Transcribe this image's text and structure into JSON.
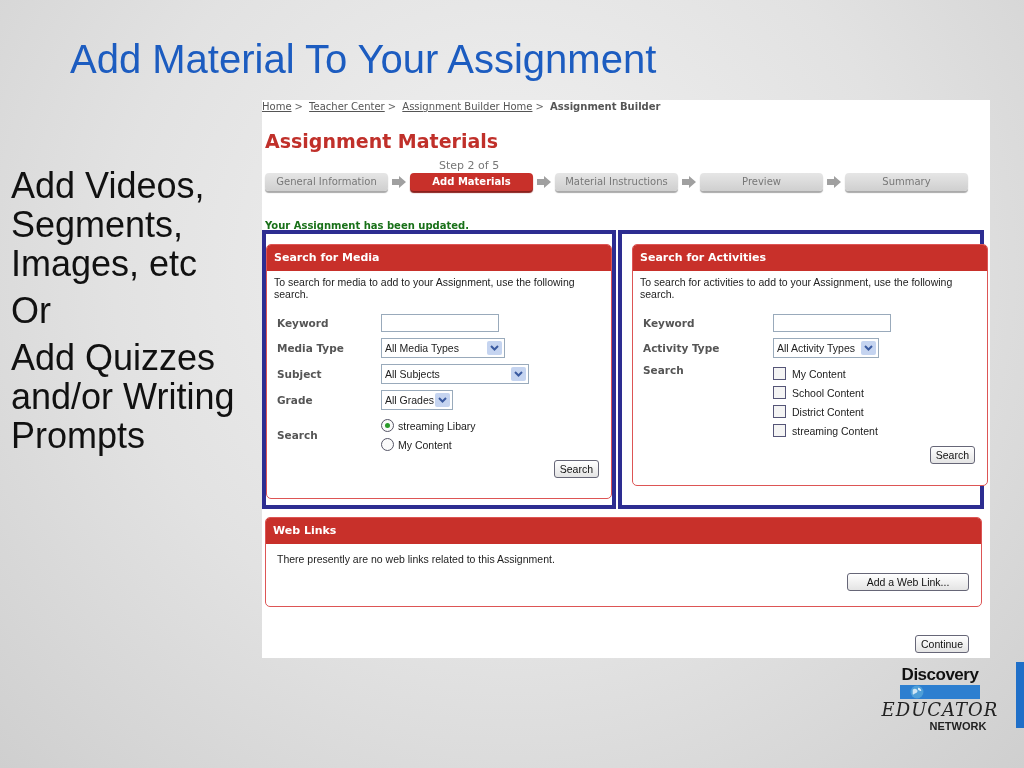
{
  "slide": {
    "title": "Add Material To Your Assignment",
    "bullets": [
      "Add Videos, Segments, Images, etc",
      "Or",
      "Add Quizzes and/or Writing Prompts"
    ]
  },
  "breadcrumb": [
    {
      "label": "Home",
      "current": false
    },
    {
      "label": "Teacher Center",
      "current": false
    },
    {
      "label": "Assignment Builder Home",
      "current": false
    },
    {
      "label": "Assignment Builder",
      "current": true
    }
  ],
  "breadcrumb_separator": ">",
  "page_title": "Assignment Materials",
  "step_indicator": "Step 2 of 5",
  "steps": [
    {
      "label": "General Information",
      "selected": false
    },
    {
      "label": "Add Materials",
      "selected": true
    },
    {
      "label": "Material Instructions",
      "selected": false
    },
    {
      "label": "Preview",
      "selected": false
    },
    {
      "label": "Summary",
      "selected": false
    }
  ],
  "status_message": "Your Assignment has been updated.",
  "search_panels": [
    {
      "title": "Search for Media",
      "intro": "To search for media to add to your Assignment, use the following search.",
      "fields": [
        {
          "kind": "text",
          "label": "Keyword"
        },
        {
          "kind": "select",
          "label": "Media Type",
          "value": "All Media Types"
        },
        {
          "kind": "select",
          "label": "Subject",
          "value": "All Subjects"
        },
        {
          "kind": "select",
          "label": "Grade",
          "value": "All Grades"
        },
        {
          "kind": "radio",
          "label": "Search",
          "options": [
            {
              "label": "streaming Libary",
              "selected": true
            },
            {
              "label": "My Content",
              "selected": false
            }
          ]
        }
      ],
      "button": "Search"
    },
    {
      "title": "Search for Activities",
      "intro": "To search for activities to add to your Assignment, use the following search.",
      "fields": [
        {
          "kind": "text",
          "label": "Keyword"
        },
        {
          "kind": "select",
          "label": "Activity Type",
          "value": "All Activity Types"
        },
        {
          "kind": "checkbox",
          "label": "Search",
          "options": [
            {
              "label": "My Content",
              "checked": false
            },
            {
              "label": "School Content",
              "checked": false
            },
            {
              "label": "District Content",
              "checked": false
            },
            {
              "label": "streaming Content",
              "checked": false
            }
          ]
        }
      ],
      "button": "Search"
    }
  ],
  "web_links": {
    "title": "Web Links",
    "message": "There presently are no web links related to this Assignment.",
    "button": "Add a Web Link..."
  },
  "continue_button": "Continue",
  "logo": {
    "top": "Discovery",
    "middle": "EDUCATOR",
    "bottom": "NETWORK"
  }
}
